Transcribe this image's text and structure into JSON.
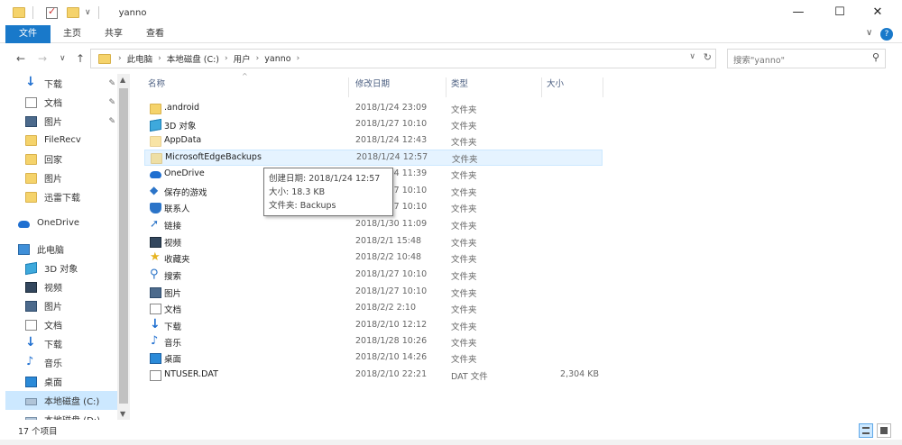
{
  "window": {
    "title": "yanno",
    "minimize": "—",
    "maximize": "☐",
    "close": "✕"
  },
  "ribbon": {
    "tabs": [
      "文件",
      "主页",
      "共享",
      "查看"
    ],
    "collapse": "∨",
    "help": "?"
  },
  "nav": {
    "back": "←",
    "forward": "→",
    "recent": "∨",
    "up": "↑"
  },
  "address": {
    "crumbs": [
      "此电脑",
      "本地磁盘 (C:)",
      "用户",
      "yanno"
    ],
    "sep": "›",
    "dropdown": "∨",
    "refresh": "↻"
  },
  "search": {
    "placeholder": "搜索\"yanno\"",
    "icon": "search-icon"
  },
  "sidebar": {
    "items": [
      {
        "label": "下载",
        "icon": "download-icon",
        "pinned": true
      },
      {
        "label": "文档",
        "icon": "document-icon",
        "pinned": true
      },
      {
        "label": "图片",
        "icon": "picture-icon",
        "pinned": true
      },
      {
        "label": "FileRecv",
        "icon": "folder-icon",
        "pinned": false
      },
      {
        "label": "回家",
        "icon": "folder-icon",
        "pinned": false
      },
      {
        "label": "图片",
        "icon": "folder-icon",
        "pinned": false
      },
      {
        "label": "迅雷下载",
        "icon": "folder-icon",
        "pinned": false
      },
      {
        "label": "OneDrive",
        "icon": "onedrive-icon",
        "pinned": false
      },
      {
        "label": "此电脑",
        "icon": "computer-icon",
        "pinned": false
      },
      {
        "label": "3D 对象",
        "icon": "3d-objects-icon",
        "pinned": false
      },
      {
        "label": "视频",
        "icon": "video-icon",
        "pinned": false
      },
      {
        "label": "图片",
        "icon": "picture-icon",
        "pinned": false
      },
      {
        "label": "文档",
        "icon": "document-icon",
        "pinned": false
      },
      {
        "label": "下载",
        "icon": "download-icon",
        "pinned": false
      },
      {
        "label": "音乐",
        "icon": "music-icon",
        "pinned": false
      },
      {
        "label": "桌面",
        "icon": "desktop-icon",
        "pinned": false
      },
      {
        "label": "本地磁盘 (C:)",
        "icon": "drive-icon",
        "pinned": false,
        "selected": true
      },
      {
        "label": "本地磁盘 (D:)",
        "icon": "drive-icon",
        "pinned": false
      }
    ],
    "pin_glyph": "✎"
  },
  "columns": {
    "name": "名称",
    "date": "修改日期",
    "type": "类型",
    "size": "大小",
    "sort": "^"
  },
  "files": [
    {
      "name": ".android",
      "date": "2018/1/24 23:09",
      "type": "文件夹",
      "size": "",
      "icon": "folder-icon"
    },
    {
      "name": "3D 对象",
      "date": "2018/1/27 10:10",
      "type": "文件夹",
      "size": "",
      "icon": "3d-objects-icon"
    },
    {
      "name": "AppData",
      "date": "2018/1/24 12:43",
      "type": "文件夹",
      "size": "",
      "icon": "folder-icon"
    },
    {
      "name": "MicrosoftEdgeBackups",
      "date": "2018/1/24 12:57",
      "type": "文件夹",
      "size": "",
      "icon": "folder-icon"
    },
    {
      "name": "OneDrive",
      "date": "2018/1/24 11:39",
      "type": "文件夹",
      "size": "",
      "icon": "onedrive-icon"
    },
    {
      "name": "保存的游戏",
      "date": "2018/1/27 10:10",
      "type": "文件夹",
      "size": "",
      "icon": "saved-games-icon"
    },
    {
      "name": "联系人",
      "date": "2018/1/27 10:10",
      "type": "文件夹",
      "size": "",
      "icon": "contacts-icon"
    },
    {
      "name": "链接",
      "date": "2018/1/30 11:09",
      "type": "文件夹",
      "size": "",
      "icon": "links-icon"
    },
    {
      "name": "视频",
      "date": "2018/2/1 15:48",
      "type": "文件夹",
      "size": "",
      "icon": "video-icon"
    },
    {
      "name": "收藏夹",
      "date": "2018/2/2 10:48",
      "type": "文件夹",
      "size": "",
      "icon": "favorites-icon"
    },
    {
      "name": "搜索",
      "date": "2018/1/27 10:10",
      "type": "文件夹",
      "size": "",
      "icon": "search-folder-icon"
    },
    {
      "name": "图片",
      "date": "2018/1/27 10:10",
      "type": "文件夹",
      "size": "",
      "icon": "picture-icon"
    },
    {
      "name": "文档",
      "date": "2018/2/2 2:10",
      "type": "文件夹",
      "size": "",
      "icon": "document-icon"
    },
    {
      "name": "下载",
      "date": "2018/2/10 12:12",
      "type": "文件夹",
      "size": "",
      "icon": "download-icon"
    },
    {
      "name": "音乐",
      "date": "2018/1/28 10:26",
      "type": "文件夹",
      "size": "",
      "icon": "music-icon"
    },
    {
      "name": "桌面",
      "date": "2018/2/10 14:26",
      "type": "文件夹",
      "size": "",
      "icon": "desktop-icon"
    },
    {
      "name": "NTUSER.DAT",
      "date": "2018/2/10 22:21",
      "type": "DAT 文件",
      "size": "2,304 KB",
      "icon": "file-icon"
    }
  ],
  "tooltip": {
    "line1": "创建日期: 2018/1/24 12:57",
    "line2": "大小: 18.3 KB",
    "line3": "文件夹: Backups"
  },
  "status": {
    "count": "17 个项目"
  }
}
